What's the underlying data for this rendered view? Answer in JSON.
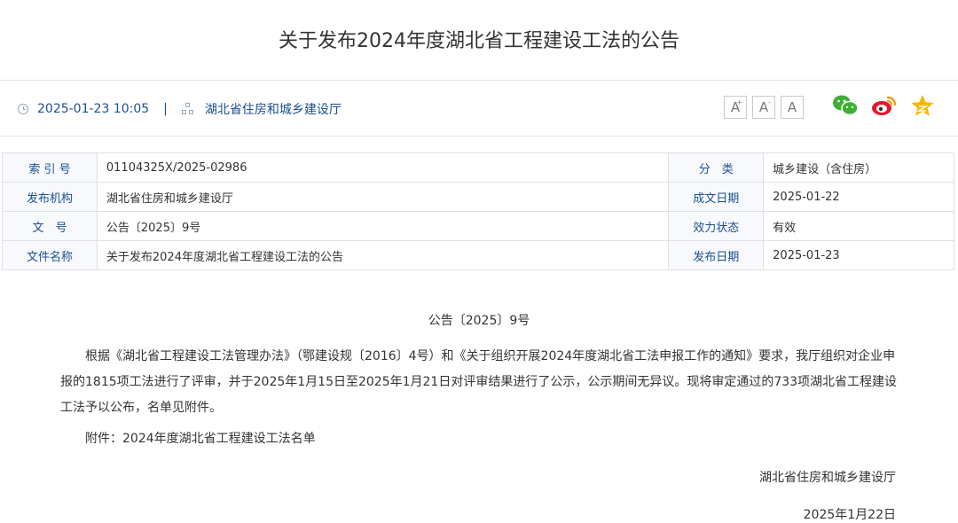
{
  "page": {
    "title": "关于发布2024年度湖北省工程建设工法的公告",
    "datetime": "2025-01-23 10:05",
    "separator": "|",
    "source": "湖北省住房和城乡建设厅"
  },
  "font_controls": [
    {
      "label": "A",
      "mark": "+"
    },
    {
      "label": "A",
      "mark": "-"
    },
    {
      "label": "A",
      "mark": ""
    }
  ],
  "share_icons": [
    "wechat-icon",
    "weibo-icon",
    "favorite-star-icon"
  ],
  "colors": {
    "link_blue": "#1c4f93",
    "wechat_green": "#3cb034",
    "weibo_orange": "#f29c1f",
    "star_gold": "#f5b800"
  },
  "info_table": {
    "rows": [
      {
        "label1": "索 引 号",
        "value1": "01104325X/2025-02986",
        "label2": "分　类",
        "value2": "城乡建设（含住房）"
      },
      {
        "label1": "发布机构",
        "value1": "湖北省住房和城乡建设厅",
        "label2": "成文日期",
        "value2": "2025-01-22"
      },
      {
        "label1": "文　号",
        "value1": "公告〔2025〕9号",
        "label2": "效力状态",
        "value2": "有效"
      },
      {
        "label1": "文件名称",
        "value1": "关于发布2024年度湖北省工程建设工法的公告",
        "label2": "发布日期",
        "value2": "2025-01-23"
      }
    ]
  },
  "content": {
    "doc_number": "公告〔2025〕9号",
    "paragraph": "根据《湖北省工程建设工法管理办法》（鄂建设规〔2016〕4号）和《关于组织开展2024年度湖北省工法申报工作的通知》要求，我厅组织对企业申报的1815项工法进行了评审，并于2025年1月15日至2025年1月21日对评审结果进行了公示，公示期间无异议。现将审定通过的733项湖北省工程建设工法予以公布，名单见附件。",
    "attachment": "附件：2024年度湖北省工程建设工法名单",
    "signature_org": "湖北省住房和城乡建设厅",
    "signature_date": "2025年1月22日"
  }
}
